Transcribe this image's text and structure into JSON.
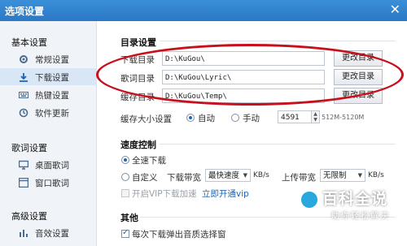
{
  "window": {
    "title": "选项设置",
    "close_glyph": "✕"
  },
  "sidebar": {
    "groups": [
      {
        "label": "基本设置",
        "items": [
          {
            "label": "常规设置",
            "icon": "gear-icon"
          },
          {
            "label": "下载设置",
            "icon": "download-icon",
            "active": true
          },
          {
            "label": "热键设置",
            "icon": "keyboard-icon"
          },
          {
            "label": "软件更新",
            "icon": "update-icon"
          }
        ]
      },
      {
        "label": "歌词设置",
        "items": [
          {
            "label": "桌面歌词",
            "icon": "desktop-lyric-icon"
          },
          {
            "label": "窗口歌词",
            "icon": "window-lyric-icon"
          }
        ]
      },
      {
        "label": "高级设置",
        "items": [
          {
            "label": "音效设置",
            "icon": "equalizer-icon"
          }
        ]
      }
    ]
  },
  "directory": {
    "title": "目录设置",
    "rows": [
      {
        "label": "下载目录",
        "value": "D:\\KuGou\\",
        "button": "更改目录"
      },
      {
        "label": "歌词目录",
        "value": "D:\\KuGou\\Lyric\\",
        "button": "更改目录"
      },
      {
        "label": "缓存目录",
        "value": "D:\\KuGou\\Temp\\",
        "button": "更改目录"
      }
    ],
    "cache_size": {
      "label": "缓存大小设置",
      "auto": "自动",
      "manual": "手动",
      "value": "4591",
      "range": "512M-5120M"
    }
  },
  "speed": {
    "title": "速度控制",
    "full_speed": "全速下载",
    "custom": "自定义",
    "download_bw_label": "下载带宽",
    "download_bw_value": "最快速度",
    "unit": "KB/s",
    "upload_bw_label": "上传带宽",
    "upload_bw_value": "无限制",
    "vip_boost": "开启VIP下载加速",
    "vip_link": "立即开通vip"
  },
  "other": {
    "title": "其他",
    "quality_popup": "每次下载弹出音质选择窗"
  },
  "watermark": {
    "title": "百科全说",
    "subtitle": "助你轻松解决"
  },
  "colors": {
    "titlebar": "#2a78c6",
    "highlight_oval": "#c8101d",
    "active_item": "#d8e6f5"
  }
}
